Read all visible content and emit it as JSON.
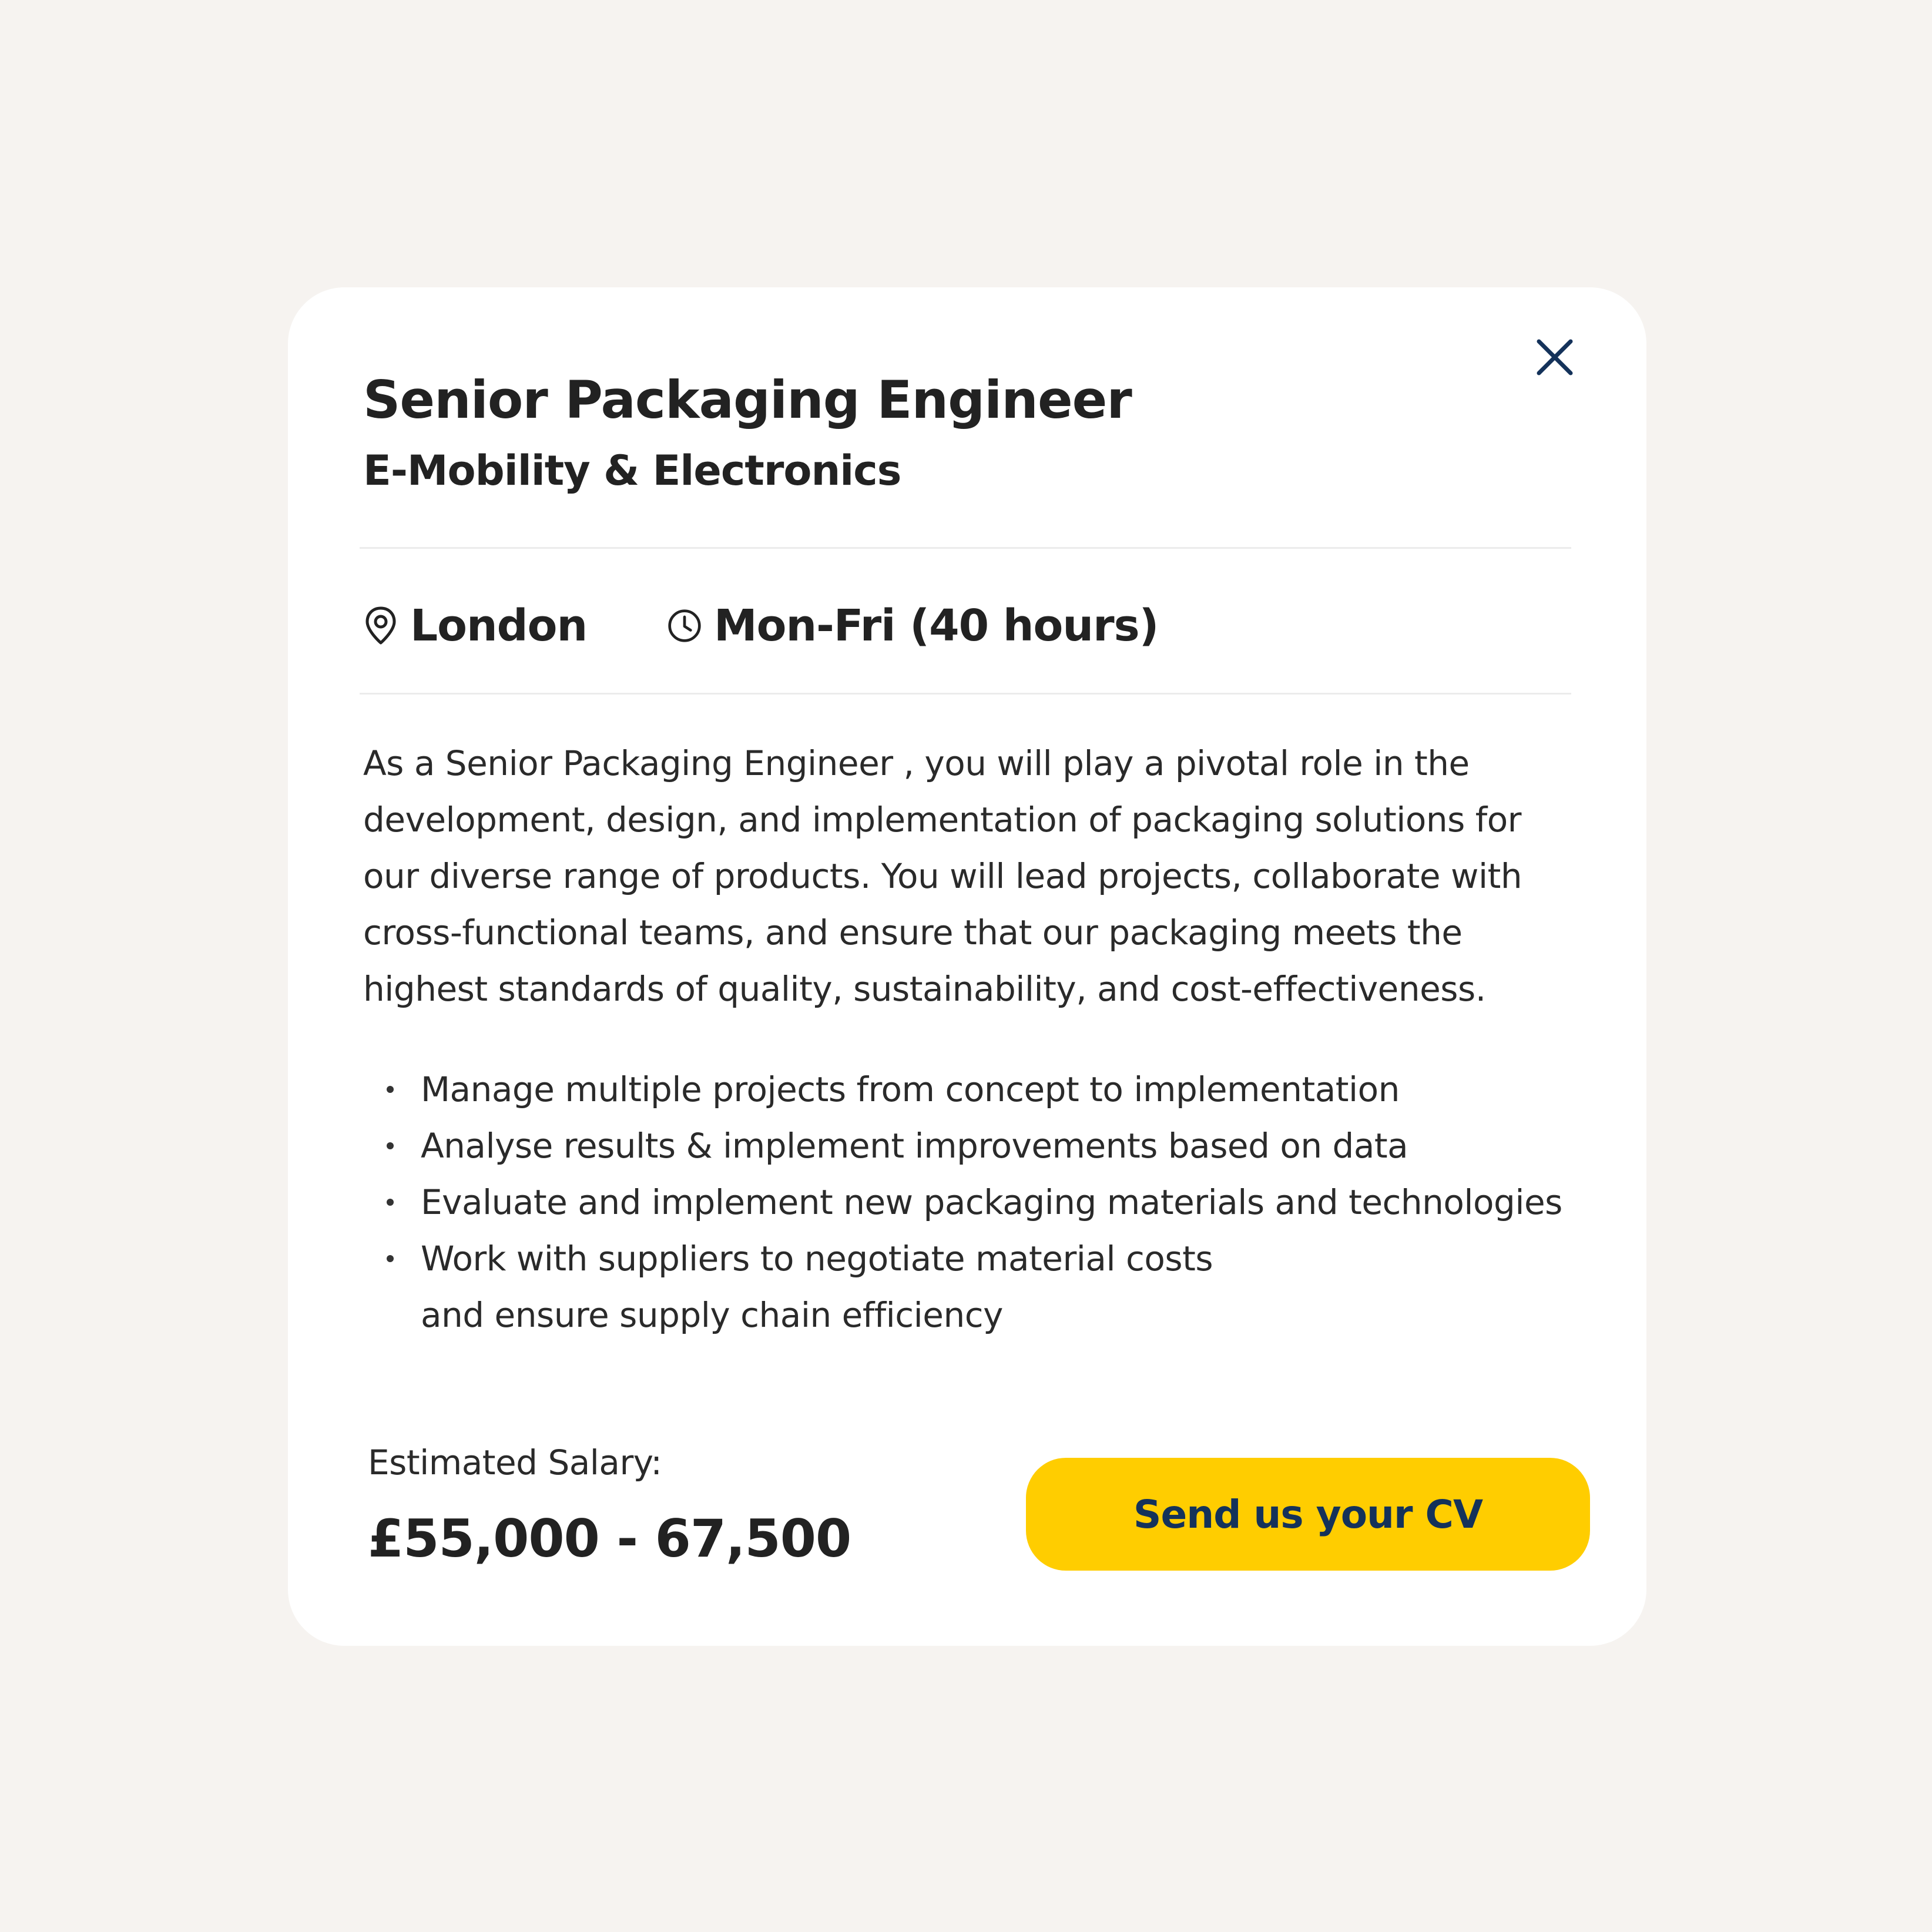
{
  "colors": {
    "page_background": "#f6f3f0",
    "card_background": "#ffffff",
    "text_primary": "#222222",
    "button_background": "#ffcd00",
    "button_text": "#14325a",
    "close_icon": "#14325a"
  },
  "dialog": {
    "close_icon": "close-icon",
    "title": "Senior Packaging Engineer",
    "subtitle": "E-Mobility & Electronics"
  },
  "meta": {
    "location": {
      "icon": "location-pin-icon",
      "label": "London"
    },
    "hours": {
      "icon": "clock-icon",
      "label": "Mon-Fri (40 hours)"
    }
  },
  "description": {
    "lines": [
      "As a Senior Packaging Engineer , you will play a pivotal role in the",
      "development, design, and implementation of packaging solutions for",
      "our diverse range of products. You will lead projects, collaborate with",
      "cross-functional teams, and ensure that our packaging meets the",
      "highest standards of quality, sustainability, and cost-effectiveness."
    ]
  },
  "responsibilities": [
    {
      "lines": [
        "Manage multiple projects from concept to implementation"
      ]
    },
    {
      "lines": [
        "Analyse results & implement improvements based on data"
      ]
    },
    {
      "lines": [
        "Evaluate and implement new packaging materials and technologies"
      ]
    },
    {
      "lines": [
        "Work with suppliers to negotiate material costs",
        "and ensure supply chain efficiency"
      ]
    }
  ],
  "salary": {
    "label": "Estimated Salary:",
    "value": "£55,000 - 67,500"
  },
  "cta": {
    "label": "Send us your CV"
  }
}
